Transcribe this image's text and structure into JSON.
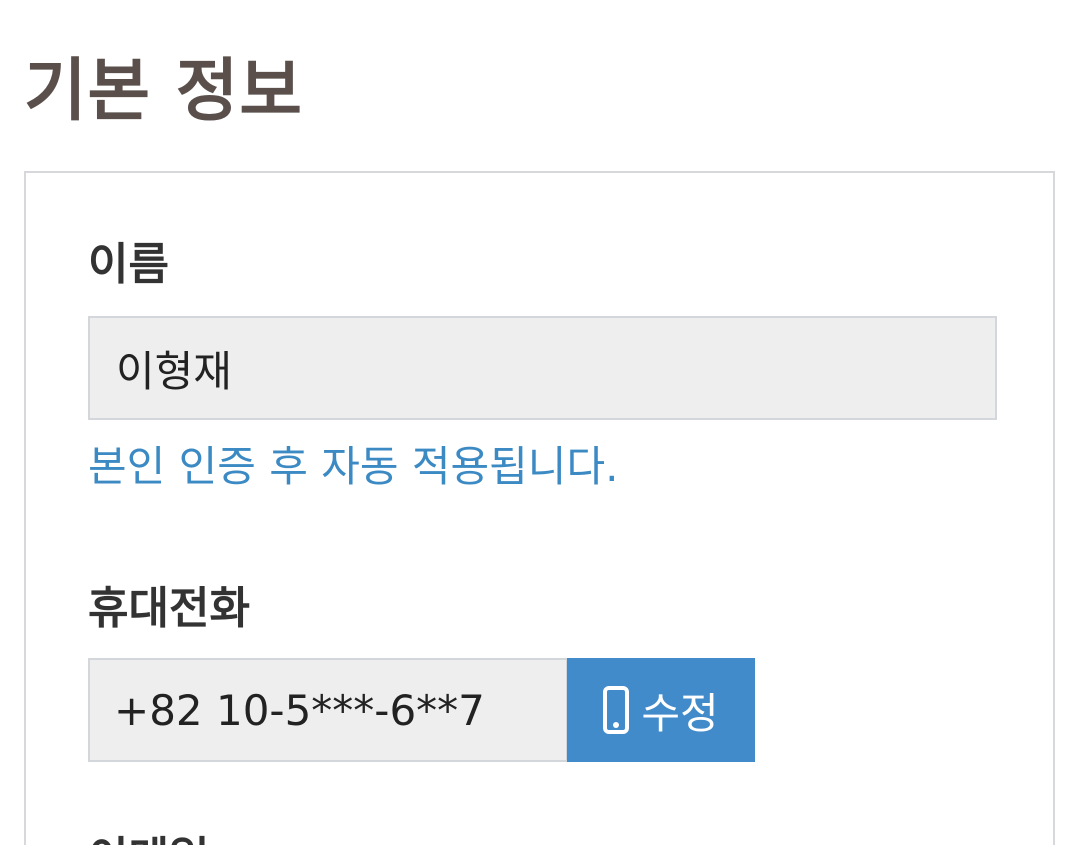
{
  "section": {
    "title": "기본 정보"
  },
  "form": {
    "name": {
      "label": "이름",
      "value": "이형재",
      "helper": "본인 인증 후 자동 적용됩니다."
    },
    "phone": {
      "label": "휴대전화",
      "value": "+82 10-5***-6**7",
      "edit_label": "수정",
      "edit_icon": "mobile-phone-icon"
    },
    "email": {
      "label": "이메일"
    }
  },
  "colors": {
    "title": "#5a4f4b",
    "helper_text": "#3c8ac4",
    "button_bg": "#428bca",
    "input_bg": "#eeeeee",
    "border": "#d6d8db"
  }
}
